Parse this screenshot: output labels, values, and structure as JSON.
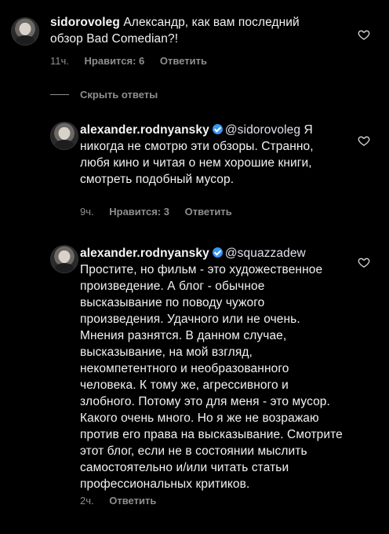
{
  "comments": [
    {
      "username": "sidorovoleg",
      "text": " Александр, как вам последний обзор Bad Comedian?!",
      "time": "11ч.",
      "likes": "Нравится: 6",
      "reply": "Ответить",
      "verified": false
    },
    {
      "username": "alexander.rodnyansky",
      "mention": "@sidorovoleg",
      "text": " Я никогда не смотрю эти обзоры. Странно, любя кино и читая о нем хорошие книги, смотреть подобный мусор.",
      "time": "9ч.",
      "likes": "Нравится: 3",
      "reply": "Ответить",
      "verified": true
    },
    {
      "username": "alexander.rodnyansky",
      "mention": "@squazzadew",
      "text": " Простите, но фильм - это художественное произведение. А блог - обычное высказывание по поводу чужого произведения. Удачного или не очень. Мнения разнятся. В данном случае, высказывание, на мой взгляд, некомпетентного и необразованного человека. К тому же, агрессивного и злобного. Потому это для меня - это мусор. Какого очень много.  Но я же не возражаю против его права на высказывание. Смотрите этот блог, если не в состоянии мыслить самостоятельно и/или читать статьи профессиональных критиков.",
      "time": "2ч.",
      "reply": "Ответить",
      "verified": true
    }
  ],
  "hide_replies": "Скрыть ответы",
  "icons": {
    "heart": "heart-outline-icon",
    "verified": "verified-badge-icon"
  },
  "colors": {
    "background": "#000000",
    "muted": "#8e8e8e",
    "verified": "#3897f0"
  }
}
